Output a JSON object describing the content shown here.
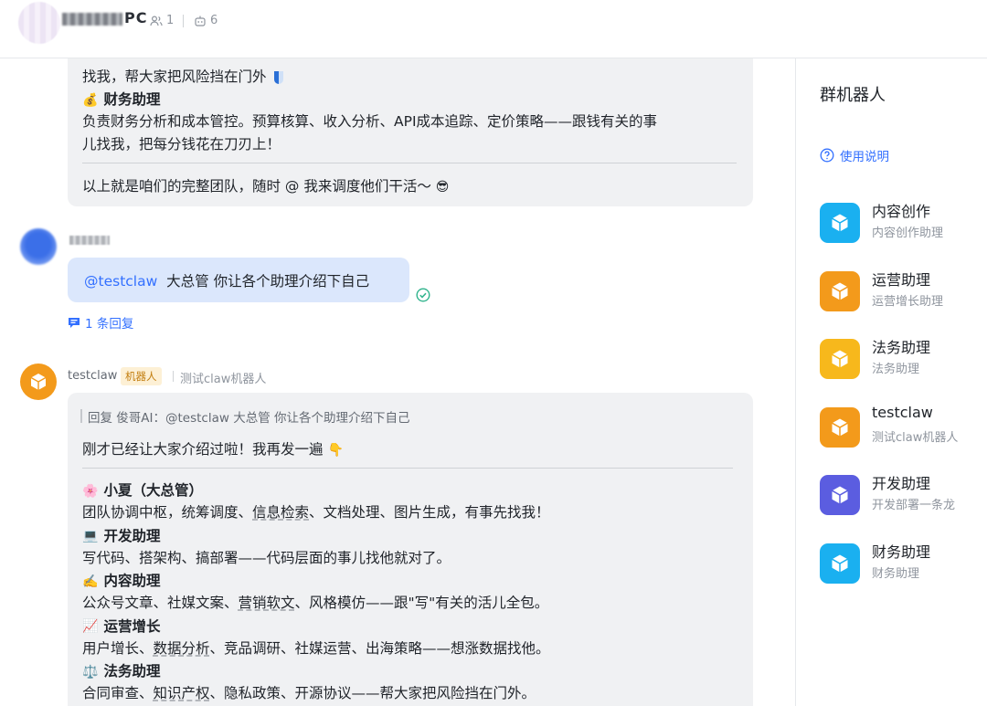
{
  "header": {
    "group_name_suffix": "PC",
    "member_count": "1",
    "bot_count": "6"
  },
  "messages": {
    "prev_bot": {
      "line_a": "找我，帮大家把风险挡在门外",
      "finance_title": "财务助理",
      "finance_desc_1": "负责财务分析和成本管控。预算核算、收入分析、API成本追踪、定价策略——跟钱有关的事",
      "finance_desc_2": "儿找我，把每分钱花在刀刃上！",
      "closing": "以上就是咱们的完整团队，随时 @ 我来调度他们干活～"
    },
    "user": {
      "mention": "@testclaw",
      "text": "大总管 你让各个助理介绍下自己",
      "reply_count": "1 条回复"
    },
    "bot": {
      "name": "testclaw",
      "badge": "机器人",
      "desc": "测试claw机器人",
      "quote": "回复 俊哥AI：@testclaw 大总管 你让各个助理介绍下自己",
      "intro": "刚才已经让大家介绍过啦！我再发一遍",
      "sections": [
        {
          "title": "小夏（大总管）",
          "icon": "flower-icon",
          "emoji": "🌸",
          "desc_parts": [
            "团队协调中枢，统筹调度、",
            "信息检索",
            "、文档处理、图片生成，有事先找我！"
          ]
        },
        {
          "title": "开发助理",
          "icon": "computer-icon",
          "emoji": "💻",
          "desc_parts": [
            "写代码、搭架构、搞部署——代码层面的事儿找他就对了。",
            "",
            ""
          ]
        },
        {
          "title": "内容助理",
          "icon": "writing-hand-icon",
          "emoji": "✍️",
          "desc_parts": [
            "公众号文章、社媒文案、",
            "营销软文",
            "、风格模仿——跟\"写\"有关的活儿全包。"
          ]
        },
        {
          "title": "运营增长",
          "icon": "chart-up-icon",
          "emoji": "📈",
          "desc_parts": [
            "用户增长、",
            "数据分析",
            "、竞品调研、社媒运营、出海策略——想涨数据找他。"
          ]
        },
        {
          "title": "法务助理",
          "icon": "scales-icon",
          "emoji": "⚖️",
          "desc_parts": [
            "合同审查、",
            "知识产权",
            "、隐私政策、开源协议——帮大家把风险挡在门外。"
          ]
        }
      ]
    }
  },
  "sidebar": {
    "title": "群机器人",
    "help": "使用说明",
    "bots": [
      {
        "name": "内容创作",
        "sub": "内容创作助理",
        "color": "#1ab0f0"
      },
      {
        "name": "运营助理",
        "sub": "运营增长助理",
        "color": "#f39a1b"
      },
      {
        "name": "法务助理",
        "sub": "法务助理",
        "color": "#f7b81c"
      },
      {
        "name": "testclaw",
        "sub": "测试claw机器人",
        "color": "#f39a1b"
      },
      {
        "name": "开发助理",
        "sub": "开发部署一条龙",
        "color": "#5b5de0"
      },
      {
        "name": "财务助理",
        "sub": "财务助理",
        "color": "#1ab0f0"
      }
    ]
  }
}
